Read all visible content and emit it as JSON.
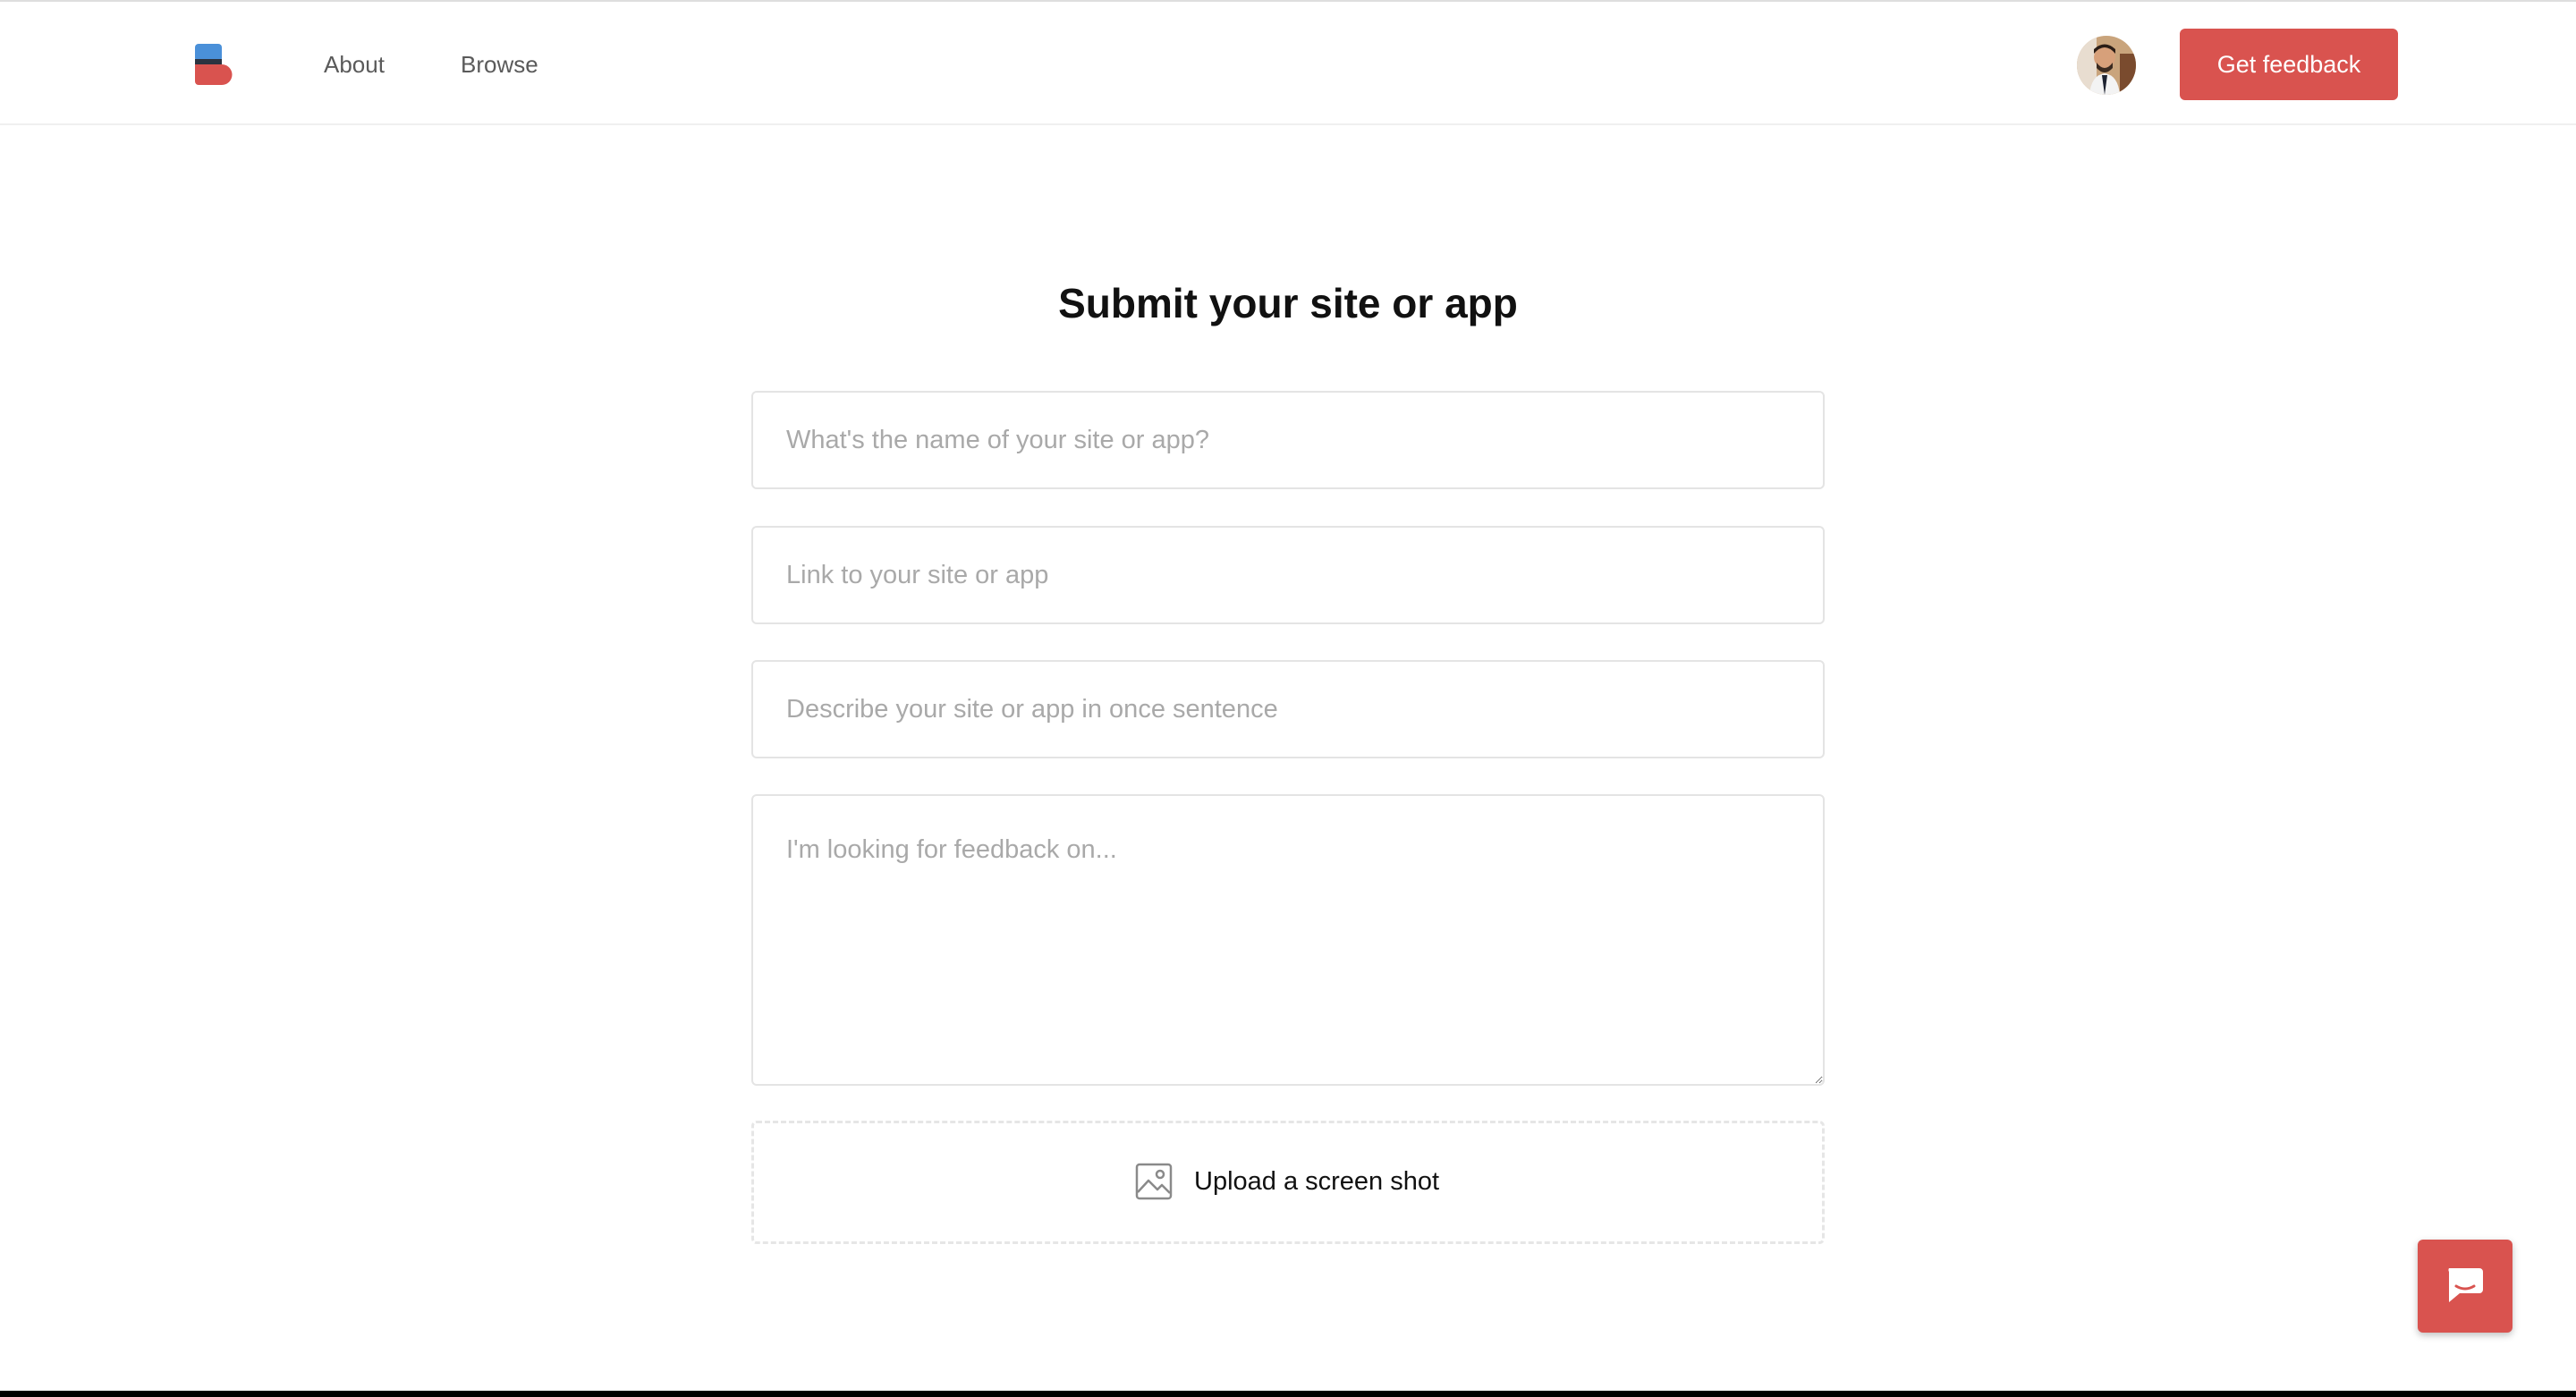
{
  "nav": {
    "logo_icon": "brand-logo-icon",
    "about_label": "About",
    "browse_label": "Browse",
    "avatar_icon": "user-avatar",
    "cta_label": "Get feedback"
  },
  "form": {
    "title": "Submit your site or app",
    "name_placeholder": "What's the name of your site or app?",
    "link_placeholder": "Link to your site or app",
    "description_placeholder": "Describe your site or app in once sentence",
    "feedback_placeholder": "I'm looking for feedback on...",
    "upload_icon": "image-icon",
    "upload_label": "Upload a screen shot"
  },
  "chat": {
    "icon": "chat-bubble-icon"
  },
  "colors": {
    "accent": "#d9534f",
    "logo_blue": "#4a90d9",
    "logo_dark": "#2b3340",
    "border": "#e4e4e4",
    "placeholder": "#a9a9a9"
  }
}
